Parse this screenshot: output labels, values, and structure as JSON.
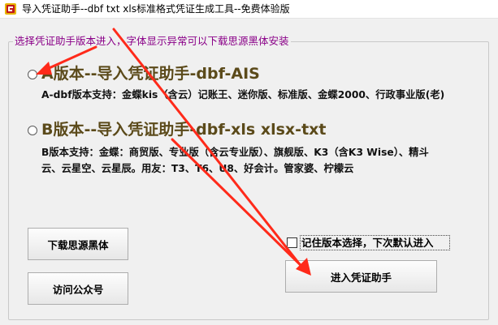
{
  "window": {
    "title": "导入凭证助手--dbf txt xls标准格式凭证生成工具--免费体验版"
  },
  "group": {
    "legend": "选择凭证助手版本进入，字体显示异常可以下载思源黑体安装"
  },
  "options": [
    {
      "title": "A版本--导入凭证助手-dbf-AIS",
      "desc_lines": [
        "A-dbf版本支持：金蝶kis（含云）记账王、迷你版、标准版、金蝶2000、行政事业版(老)"
      ],
      "selected": false
    },
    {
      "title": "B版本--导入凭证助手-dbf-xls xlsx-txt",
      "desc_lines": [
        "B版本支持：金蝶：商贸版、专业版（含云专业版）、旗舰版、K3（含K3 Wise）、精斗",
        "云、云星空、云星辰。用友：T3、T6、U8、好会计。管家婆、柠檬云"
      ],
      "selected": false
    }
  ],
  "buttons": {
    "download_font": "下载思源黑体",
    "visit_wechat": "访问公众号",
    "enter": "进入凭证助手"
  },
  "remember": {
    "label": "记住版本选择，下次默认进入",
    "checked": false
  },
  "colors": {
    "legend": "#8a0088",
    "option_title": "#5b4a1a",
    "annotation_arrow": "#ff2a1a"
  }
}
